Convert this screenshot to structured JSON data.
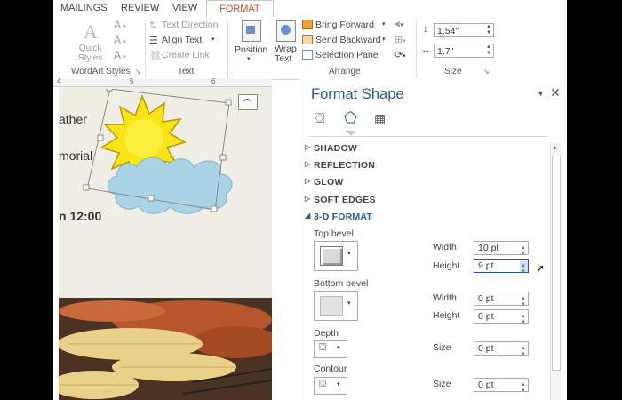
{
  "tabs": {
    "mailings": "MAILINGS",
    "review": "REVIEW",
    "view": "VIEW",
    "format": "FORMAT"
  },
  "ribbon": {
    "wordart": {
      "quick_styles": "Quick\nStyles",
      "group_label": "WordArt Styles"
    },
    "text": {
      "text_direction": "Text Direction",
      "align_text": "Align Text",
      "create_link": "Create Link",
      "group_label": "Text"
    },
    "arrange": {
      "position": "Position",
      "wrap_text": "Wrap\nText",
      "bring_forward": "Bring Forward",
      "send_backward": "Send Backward",
      "selection_pane": "Selection Pane",
      "group_label": "Arrange"
    },
    "size": {
      "height": "1.54\"",
      "width": "1.7\"",
      "group_label": "Size"
    }
  },
  "ruler": {
    "marks": [
      "4",
      "5",
      "6"
    ]
  },
  "document": {
    "line1": "ather",
    "line2": "morial",
    "line3": "n 12:00"
  },
  "format_pane": {
    "title": "Format Shape",
    "sections": {
      "shadow": "SHADOW",
      "reflection": "REFLECTION",
      "glow": "GLOW",
      "soft_edges": "SOFT EDGES",
      "three_d": "3-D FORMAT"
    },
    "top_bevel": {
      "label": "Top bevel",
      "width_label": "Width",
      "width": "10 pt",
      "height_label": "Height",
      "height": "9 pt"
    },
    "bottom_bevel": {
      "label": "Bottom bevel",
      "width_label": "Width",
      "width": "0 pt",
      "height_label": "Height",
      "height": "0 pt"
    },
    "depth": {
      "label": "Depth",
      "size_label": "Size",
      "size": "0 pt"
    },
    "contour": {
      "label": "Contour",
      "size_label": "Size",
      "size": "0 pt"
    }
  },
  "colors": {
    "accent": "#d24726",
    "pane_title": "#2b579a",
    "sun": "#f7e316",
    "cloud": "#a9d4e6"
  }
}
